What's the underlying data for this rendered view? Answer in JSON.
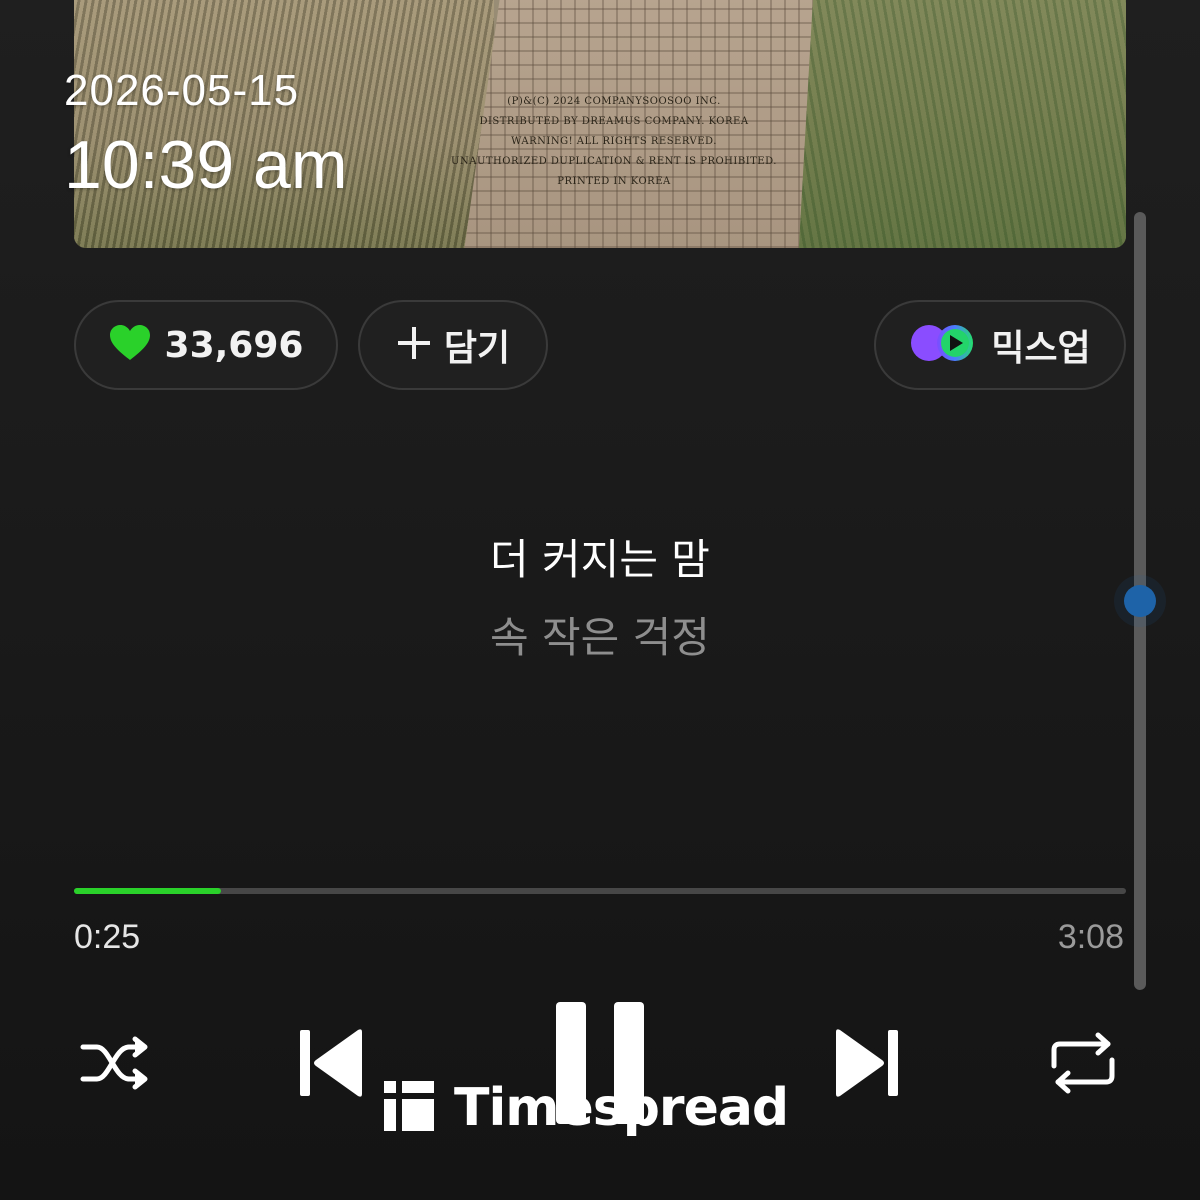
{
  "overlay": {
    "date": "2026-05-15",
    "time": "10:39 am"
  },
  "album_art": {
    "credits": [
      "(P)&(C) 2024 COMPANYSOOSOO INC.",
      "DISTRIBUTED BY DREAMUS COMPANY. KOREA",
      "WARNING! ALL RIGHTS RESERVED.",
      "UNAUTHORIZED DUPLICATION & RENT IS PROHIBITED.",
      "PRINTED IN KOREA"
    ]
  },
  "actions": {
    "like_count": "33,696",
    "like_icon": "heart-icon",
    "add_label": "담기",
    "add_icon": "plus-icon",
    "mixup_label": "믹스업",
    "mixup_icon": "mixup-icon"
  },
  "lyrics": {
    "current": "더 커지는 맘",
    "next": "속 작은 걱정"
  },
  "playback": {
    "elapsed": "0:25",
    "total": "3:08",
    "progress_fraction": 0.14,
    "scroll_position_fraction": 0.5
  },
  "controls": {
    "shuffle_icon": "shuffle-icon",
    "prev_icon": "previous-track-icon",
    "pause_icon": "pause-icon",
    "next_icon": "next-track-icon",
    "repeat_icon": "repeat-icon"
  },
  "watermark": {
    "text": "Timespread"
  },
  "colors": {
    "accent_green": "#2ad12a",
    "background": "#1b1b1b",
    "secondary_text": "#8e8e8e",
    "scroll_thumb": "#1e63a8"
  }
}
